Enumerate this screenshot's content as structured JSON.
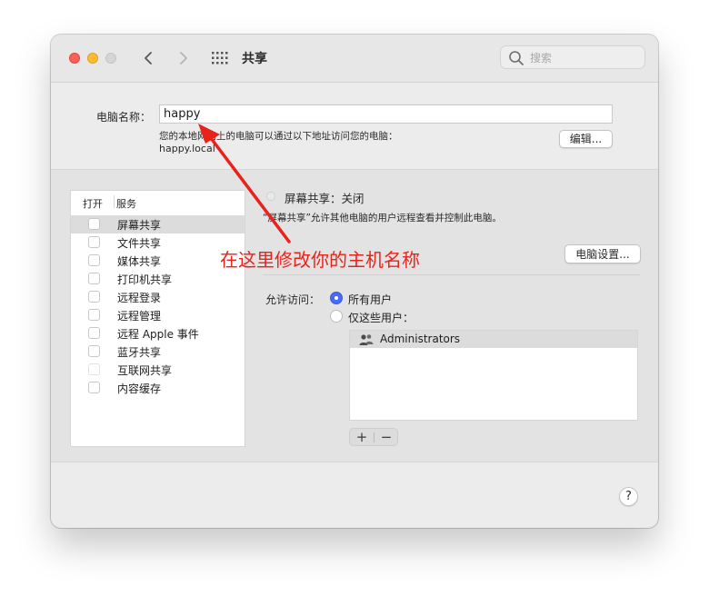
{
  "window": {
    "title": "共享",
    "search_placeholder": "搜索"
  },
  "computer_name": {
    "label": "电脑名称：",
    "value": "happy",
    "address_desc": "您的本地网络上的电脑可以通过以下地址访问您的电脑：",
    "address": "happy.local",
    "edit_button": "编辑..."
  },
  "service_list": {
    "col_open": "打开",
    "col_service": "服务",
    "items": [
      {
        "label": "屏幕共享",
        "checked": false,
        "selected": true
      },
      {
        "label": "文件共享",
        "checked": false
      },
      {
        "label": "媒体共享",
        "checked": false
      },
      {
        "label": "打印机共享",
        "checked": false
      },
      {
        "label": "远程登录",
        "checked": false
      },
      {
        "label": "远程管理",
        "checked": false
      },
      {
        "label": "远程 Apple 事件",
        "checked": false
      },
      {
        "label": "蓝牙共享",
        "checked": false
      },
      {
        "label": "互联网共享",
        "checked": false,
        "disabled": true
      },
      {
        "label": "内容缓存",
        "checked": false
      }
    ]
  },
  "detail": {
    "status": "屏幕共享：关闭",
    "description": "“屏幕共享”允许其他电脑的用户远程查看并控制此电脑。",
    "computer_settings_button": "电脑设置...",
    "allow_access_label": "允许访问：",
    "option_all_users": "所有用户",
    "option_only_users": "仅这些用户：",
    "selected_option": "所有用户",
    "users": [
      "Administrators"
    ],
    "add_symbol": "+",
    "remove_symbol": "−"
  },
  "help": "?",
  "annotation": {
    "text": "在这里修改你的主机名称",
    "color": "#e8231c"
  },
  "colors": {
    "accent": "#4c6bf4",
    "close": "#fe5f57",
    "minimize": "#febc2e"
  }
}
